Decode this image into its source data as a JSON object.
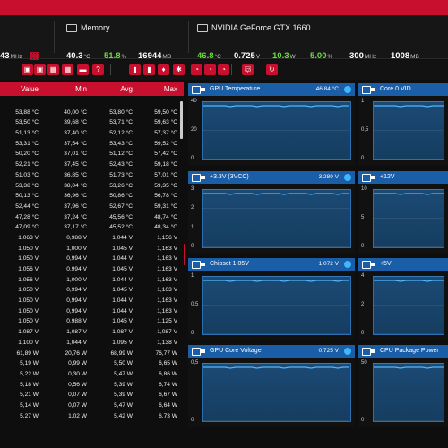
{
  "header": {
    "cpu": {
      "clock_value": "43",
      "clock_unit": "MHz"
    },
    "memory": {
      "title": "Memory",
      "values": [
        {
          "value": "40.3",
          "unit": "°C",
          "green": false
        },
        {
          "value": "51.8",
          "unit": "%",
          "green": true
        },
        {
          "value": "16944",
          "unit": "MB",
          "green": false
        }
      ]
    },
    "gpu": {
      "title": "NVIDIA GeForce GTX 1660",
      "values": [
        {
          "value": "46.8",
          "unit": "°C",
          "green": true
        },
        {
          "value": "0.725",
          "unit": "V",
          "green": false
        },
        {
          "value": "10.3",
          "unit": "W",
          "green": true
        },
        {
          "value": "5.00",
          "unit": "%",
          "green": true
        },
        {
          "value": "300",
          "unit": "MHz",
          "green": false
        },
        {
          "value": "1008",
          "unit": "MB",
          "green": false
        }
      ]
    }
  },
  "table": {
    "headers": [
      "Value",
      "Min",
      "Avg",
      "Max"
    ],
    "rows": [
      [
        "",
        "",
        "",
        ""
      ],
      [
        "53,88 °C",
        "40,00 °C",
        "53,80 °C",
        "59,50 °C"
      ],
      [
        "53,50 °C",
        "39,68 °C",
        "53,71 °C",
        "59,63 °C"
      ],
      [
        "51,13 °C",
        "37,40 °C",
        "52,12 °C",
        "57,37 °C"
      ],
      [
        "53,31 °C",
        "37,54 °C",
        "53,43 °C",
        "59,52 °C"
      ],
      [
        "50,20 °C",
        "37,01 °C",
        "51,12 °C",
        "57,42 °C"
      ],
      [
        "52,21 °C",
        "37,45 °C",
        "52,43 °C",
        "59,18 °C"
      ],
      [
        "51,03 °C",
        "36,85 °C",
        "51,73 °C",
        "57,01 °C"
      ],
      [
        "53,38 °C",
        "38,04 °C",
        "53,26 °C",
        "59,35 °C"
      ],
      [
        "50,13 °C",
        "36,96 °C",
        "50,86 °C",
        "56,78 °C"
      ],
      [
        "52,44 °C",
        "37,96 °C",
        "52,67 °C",
        "59,31 °C"
      ],
      [
        "47,28 °C",
        "37,24 °C",
        "45,56 °C",
        "48,74 °C"
      ],
      [
        "47,09 °C",
        "37,17 °C",
        "45,52 °C",
        "48,34 °C"
      ],
      [
        "1,063 V",
        "0,988 V",
        "1,044 V",
        "1,156 V"
      ],
      [
        "1,050 V",
        "1,000 V",
        "1,045 V",
        "1,163 V"
      ],
      [
        "1,050 V",
        "0,994 V",
        "1,044 V",
        "1,163 V"
      ],
      [
        "1,056 V",
        "0,994 V",
        "1,045 V",
        "1,163 V"
      ],
      [
        "1,056 V",
        "1,000 V",
        "1,044 V",
        "1,163 V"
      ],
      [
        "1,050 V",
        "0,994 V",
        "1,045 V",
        "1,163 V"
      ],
      [
        "1,050 V",
        "0,994 V",
        "1,044 V",
        "1,163 V"
      ],
      [
        "1,050 V",
        "0,994 V",
        "1,044 V",
        "1,163 V"
      ],
      [
        "1,050 V",
        "0,988 V",
        "1,045 V",
        "1,125 V"
      ],
      [
        "1,087 V",
        "1,087 V",
        "1,087 V",
        "1,087 V"
      ],
      [
        "1,100 V",
        "1,044 V",
        "1,095 V",
        "1,138 V"
      ],
      [
        "61,89 W",
        "20,76 W",
        "68,99 W",
        "76,77 W"
      ],
      [
        "5,19 W",
        "0,99 W",
        "5,50 W",
        "6,65 W"
      ],
      [
        "5,22 W",
        "0,30 W",
        "5,47 W",
        "6,86 W"
      ],
      [
        "5,18 W",
        "0,56 W",
        "5,39 W",
        "6,74 W"
      ],
      [
        "5,21 W",
        "0,07 W",
        "5,39 W",
        "6,67 W"
      ],
      [
        "5,14 W",
        "0,07 W",
        "5,47 W",
        "6,64 W"
      ],
      [
        "5,27 W",
        "1,02 W",
        "5,42 W",
        "6,73 W"
      ]
    ]
  },
  "panels": [
    {
      "name": "GPU Temperature",
      "value": "46,84 °C",
      "yticks": [
        "40",
        "20",
        "0"
      ]
    },
    {
      "name": "Core 0 VID",
      "value": "",
      "yticks": [
        "1",
        "0,5",
        "0"
      ]
    },
    {
      "name": "+3.3V (3VCC)",
      "value": "3,280 V",
      "yticks": [
        "3",
        "2",
        "1",
        "0"
      ]
    },
    {
      "name": "+12V",
      "value": "",
      "yticks": [
        "10",
        "5",
        "0"
      ]
    },
    {
      "name": "Chipset 1.05V",
      "value": "1,072 V",
      "yticks": [
        "1",
        "0,5",
        "0"
      ]
    },
    {
      "name": "+5V",
      "value": "",
      "yticks": [
        "4",
        "2",
        "0"
      ]
    },
    {
      "name": "GPU Core Voltage",
      "value": "0,725 V",
      "yticks": [
        "0,5",
        "0"
      ]
    },
    {
      "name": "CPU Package Power",
      "value": "",
      "yticks": [
        "50",
        "0"
      ]
    }
  ],
  "colors": {
    "accent": "#c8102e",
    "panel": "#1a5ea8",
    "green": "#6ddc3e"
  },
  "toolbar_icons": [
    "sensor-icon",
    "sensor-icon",
    "grid-icon",
    "grid-icon",
    "memory-icon",
    "help-icon",
    "gpu-icon",
    "gpu-icon",
    "fan-icon",
    "settings-icon",
    "gauge-icon",
    "gauge-icon",
    "gauge-icon",
    "window-icon",
    "filter-icon",
    "refresh-icon"
  ]
}
